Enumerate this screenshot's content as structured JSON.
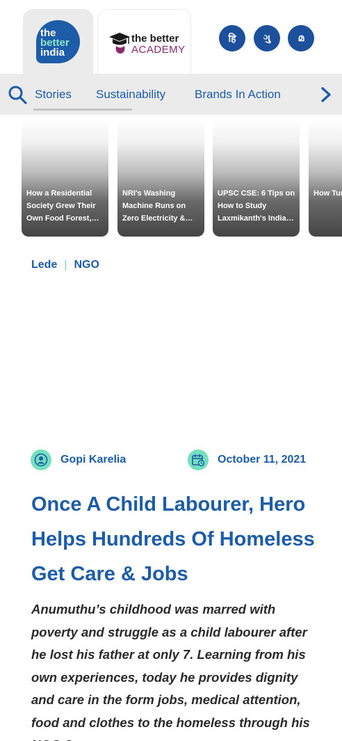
{
  "header": {
    "logo_lines": [
      "the",
      "better",
      "india"
    ],
    "academy_line1": "the better",
    "academy_line2": "ACADEMY",
    "languages": [
      {
        "label": "हि",
        "name": "hindi"
      },
      {
        "label": "ગુ",
        "name": "gujarati"
      },
      {
        "label": " മ",
        "name": "malayalam"
      }
    ]
  },
  "nav": {
    "search_icon": "search-icon",
    "items": [
      "Stories",
      "Sustainability",
      "Brands In Action"
    ],
    "next_icon": "chevron-right-icon"
  },
  "stories": [
    "How a Residential Society Grew Their Own Food Forest,…",
    "NRI's Washing Machine Runs on Zero Electricity &…",
    "UPSC CSE: 6 Tips on How to Study Laxmikanth's India…",
    "How Turr Paa"
  ],
  "tags": [
    "Lede",
    "NGO"
  ],
  "article": {
    "author": "Gopi Karelia",
    "date": "October 11, 2021",
    "headline": "Once A Child Labourer, Hero Helps Hundreds Of Homeless Get Care & Jobs",
    "excerpt": "Anumuthu’s childhood was marred with poverty and struggle as a child labourer after he lost his father at only 7. Learning from his own experiences, today he provides dignity and care in the form jobs, medical attention, food and clothes to the homeless through his NGO Sr…"
  },
  "colors": {
    "brand_blue": "#1c5ca8",
    "accent_green": "#74e0bd",
    "nav_bg": "#ebebeb"
  }
}
